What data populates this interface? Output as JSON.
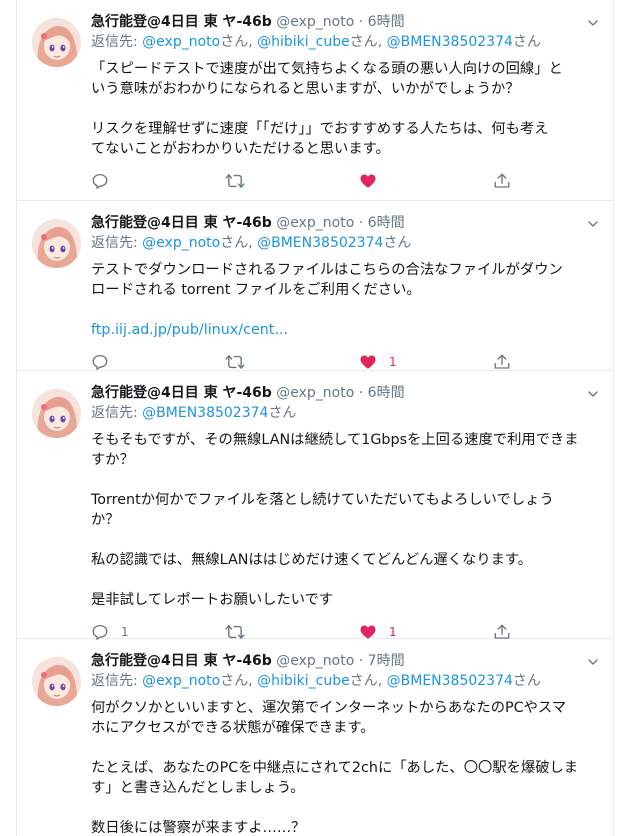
{
  "tweets": [
    {
      "name": "急行能登@4日目 東 ヤ-46b",
      "handle": "@exp_noto",
      "time": "6時間",
      "reply_prefix": "返信先: ",
      "reply_to": [
        {
          "user": "@exp_noto",
          "suffix": "さん, "
        },
        {
          "user": "@hibiki_cube",
          "suffix": "さん, "
        },
        {
          "user": "@BMEN38502374",
          "suffix": "さん"
        }
      ],
      "lines": [
        "「スピードテストで速度が出て気持ちよくなる頭の悪い人向けの回線」と",
        "いう意味がおわかりになられると思いますが、いかがでしょうか？",
        "",
        "リスクを理解せずに速度「「だけ」」でおすすめする人たちは、何も考え",
        "てないことがおわかりいただけると思います。"
      ],
      "link": "",
      "reply_count": "",
      "retweet_count": "",
      "like_count": "",
      "liked": true
    },
    {
      "name": "急行能登@4日目 東 ヤ-46b",
      "handle": "@exp_noto",
      "time": "6時間",
      "reply_prefix": "返信先: ",
      "reply_to": [
        {
          "user": "@exp_noto",
          "suffix": "さん, "
        },
        {
          "user": "@BMEN38502374",
          "suffix": "さん"
        }
      ],
      "lines": [
        "テストでダウンロードされるファイルはこちらの合法なファイルがダウン",
        "ロードされる torrent ファイルをご利用ください。",
        ""
      ],
      "link": "ftp.iij.ad.jp/pub/linux/cent...",
      "reply_count": "",
      "retweet_count": "",
      "like_count": "1",
      "liked": true
    },
    {
      "name": "急行能登@4日目 東 ヤ-46b",
      "handle": "@exp_noto",
      "time": "6時間",
      "reply_prefix": "返信先: ",
      "reply_to": [
        {
          "user": "@BMEN38502374",
          "suffix": "さん"
        }
      ],
      "lines": [
        "そもそもですが、その無線LANは継続して1Gbpsを上回る速度で利用できま",
        "すか？",
        "",
        "Torrentか何かでファイルを落とし続けていただいてもよろしいでしょう",
        "か？",
        "",
        "私の認識では、無線LANははじめだけ速くてどんどん遅くなります。",
        "",
        "是非試してレポートお願いしたいです"
      ],
      "link": "",
      "reply_count": "1",
      "retweet_count": "",
      "like_count": "1",
      "liked": true
    },
    {
      "name": "急行能登@4日目 東 ヤ-46b",
      "handle": "@exp_noto",
      "time": "7時間",
      "reply_prefix": "返信先: ",
      "reply_to": [
        {
          "user": "@exp_noto",
          "suffix": "さん, "
        },
        {
          "user": "@hibiki_cube",
          "suffix": "さん, "
        },
        {
          "user": "@BMEN38502374",
          "suffix": "さん"
        }
      ],
      "lines": [
        "何がクソかといいますと、運次第でインターネットからあなたのPCやスマ",
        "ホにアクセスができる状態が確保できます。",
        "",
        "たとえば、あなたのPCを中継点にされて2chに「あした、〇〇駅を爆破しま",
        "す」と書き込んだとしましょう。",
        "",
        "数日後には警察が来ますよ……？"
      ],
      "link": "",
      "reply_count": "",
      "retweet_count": "",
      "like_count": "",
      "liked": false
    }
  ],
  "icons": [
    "avatar",
    "chevron-down-icon",
    "reply-icon",
    "retweet-icon",
    "like-icon",
    "share-icon"
  ],
  "colors": {
    "link": "#1b95e0",
    "like": "#e0245e",
    "muted": "#657786",
    "border": "#e6ecf0",
    "text": "#14171a"
  }
}
